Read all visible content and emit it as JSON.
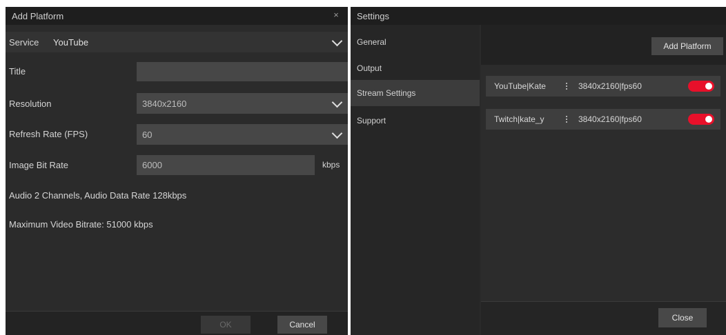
{
  "add_platform_dialog": {
    "title": "Add Platform",
    "close_glyph": "×",
    "service": {
      "label": "Service",
      "value": "YouTube"
    },
    "title_field": {
      "label": "Title",
      "value": ""
    },
    "resolution": {
      "label": "Resolution",
      "value": "3840x2160"
    },
    "refresh_rate": {
      "label": "Refresh Rate (FPS)",
      "value": "60"
    },
    "bit_rate": {
      "label": "Image Bit Rate",
      "value": "6000",
      "unit": "kbps"
    },
    "audio_info": "Audio 2 Channels, Audio Data Rate 128kbps",
    "max_bitrate_info": "Maximum Video Bitrate: 51000 kbps",
    "ok_label": "OK",
    "cancel_label": "Cancel"
  },
  "settings": {
    "title": "Settings",
    "nav": [
      {
        "label": "General",
        "active": false
      },
      {
        "label": "Output",
        "active": false
      },
      {
        "label": "Stream Settings",
        "active": true
      },
      {
        "label": "Support",
        "active": false
      }
    ],
    "add_platform_label": "Add Platform",
    "platforms": [
      {
        "name": "YouTube|Kate",
        "resolution": "3840x2160|fps60",
        "enabled": true
      },
      {
        "name": "Twitch|kate_y",
        "resolution": "3840x2160|fps60",
        "enabled": true
      }
    ],
    "close_label": "Close"
  },
  "colors": {
    "accent_toggle": "#e8102a",
    "background": "#2b2b2b"
  }
}
